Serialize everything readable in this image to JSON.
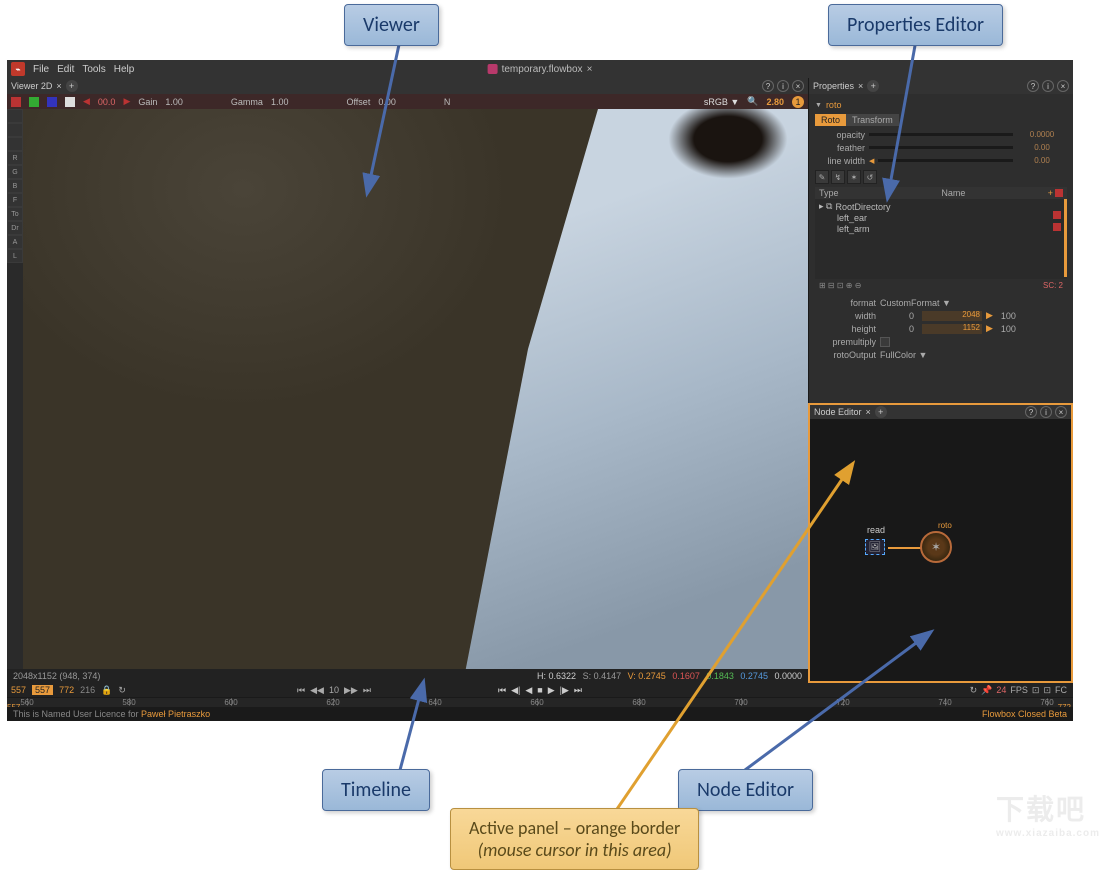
{
  "menu": {
    "file": "File",
    "edit": "Edit",
    "tools": "Tools",
    "help": "Help"
  },
  "doc": {
    "name": "temporary.flowbox"
  },
  "viewer": {
    "title": "Viewer 2D",
    "gain_label": "Gain",
    "gain": "1.00",
    "gamma_label": "Gamma",
    "gamma": "1.00",
    "offset_label": "Offset",
    "offset": "0.00",
    "n": "N",
    "colorspace": "sRGB ▼",
    "zoom": "2.80",
    "status_dims": "2048x1152 (948, 374)",
    "px": {
      "h": "H: 0.6322",
      "s": "S: 0.4147",
      "v": "V: 0.2745",
      "r": "0.1607",
      "g": "0.1843",
      "b": "0.2745",
      "a": "0.0000"
    }
  },
  "sidebar": [
    "□",
    "□",
    "□",
    "R",
    "G",
    "B",
    "F",
    "To",
    "Dr",
    "A",
    "L"
  ],
  "properties": {
    "title": "Properties",
    "node": "roto",
    "tabs": {
      "roto": "Roto",
      "transform": "Transform"
    },
    "opacity_label": "opacity",
    "opacity": "0.0000",
    "feather_label": "feather",
    "feather": "0.00",
    "linewidth_label": "line width",
    "linewidth": "0.00",
    "tree_type": "Type",
    "tree_name": "Name",
    "tree": {
      "root": "RootDirectory",
      "left_ear": "left_ear",
      "left_arm": "left_arm"
    },
    "sc": "SC: 2",
    "format_label": "format",
    "format": "CustomFormat ▼",
    "width_label": "width",
    "width_0": "0",
    "width_v": "2048",
    "width_e": "100",
    "height_label": "height",
    "height_0": "0",
    "height_v": "1152",
    "height_e": "100",
    "premult_label": "premultiply",
    "rotoout_label": "rotoOutput",
    "rotoout": "FullColor ▼"
  },
  "node_editor": {
    "title": "Node Editor",
    "read": "read",
    "roto": "roto"
  },
  "timeline": {
    "in": "557",
    "cur": "557",
    "out": "772",
    "len": "216",
    "fps": "10",
    "ticks": [
      "560",
      "580",
      "600",
      "620",
      "640",
      "660",
      "680",
      "700",
      "720",
      "740",
      "760"
    ],
    "fps_right": "24",
    "fps_label": "FPS",
    "start": "557",
    "end": "772"
  },
  "footer": {
    "license_prefix": "This is Named User Licence for ",
    "license_user": "Paweł Pietraszko",
    "beta": "Flowbox Closed Beta"
  },
  "callouts": {
    "viewer": "Viewer",
    "timeline": "Timeline",
    "node": "Node Editor",
    "props": "Properties Editor",
    "active1": "Active panel – orange border",
    "active2": "(mouse cursor in this area)"
  },
  "watermark": {
    "main": "下载吧",
    "sub": "www.xiazaiba.com"
  }
}
